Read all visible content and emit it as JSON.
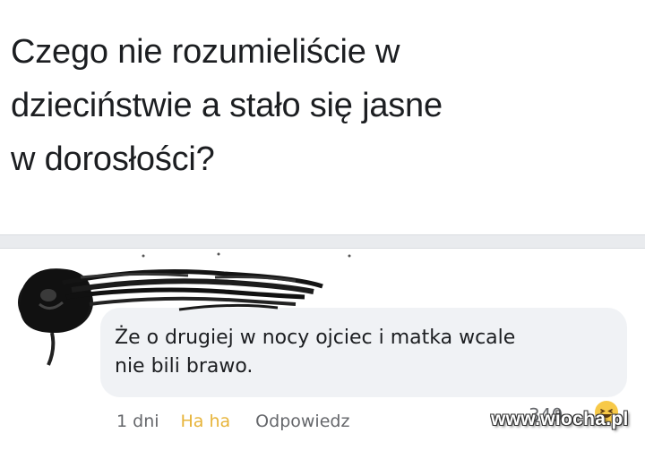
{
  "post": {
    "text_line1": "Czego nie rozumieliście w",
    "text_line2": "dzieciństwie a stało się jasne",
    "text_line3": "w dorosłości?"
  },
  "comment": {
    "text_line1": "Że o drugiej w nocy ojciec i matka wcale",
    "text_line2": "nie bili brawo.",
    "avatar_icon": "scribbled-avatar-icon"
  },
  "actions": {
    "time": "1 dni",
    "reaction_label": "Ha ha",
    "reply": "Odpowiedz"
  },
  "reactions": {
    "count": "340",
    "icon": "haha-emoji-icon"
  },
  "watermark": "www.wiocha.pl",
  "colors": {
    "text_primary": "#1c1e21",
    "text_secondary": "#65676b",
    "bubble_bg": "#f0f2f5",
    "haha_yellow": "#e7b43a",
    "divider": "#e9ebee"
  }
}
